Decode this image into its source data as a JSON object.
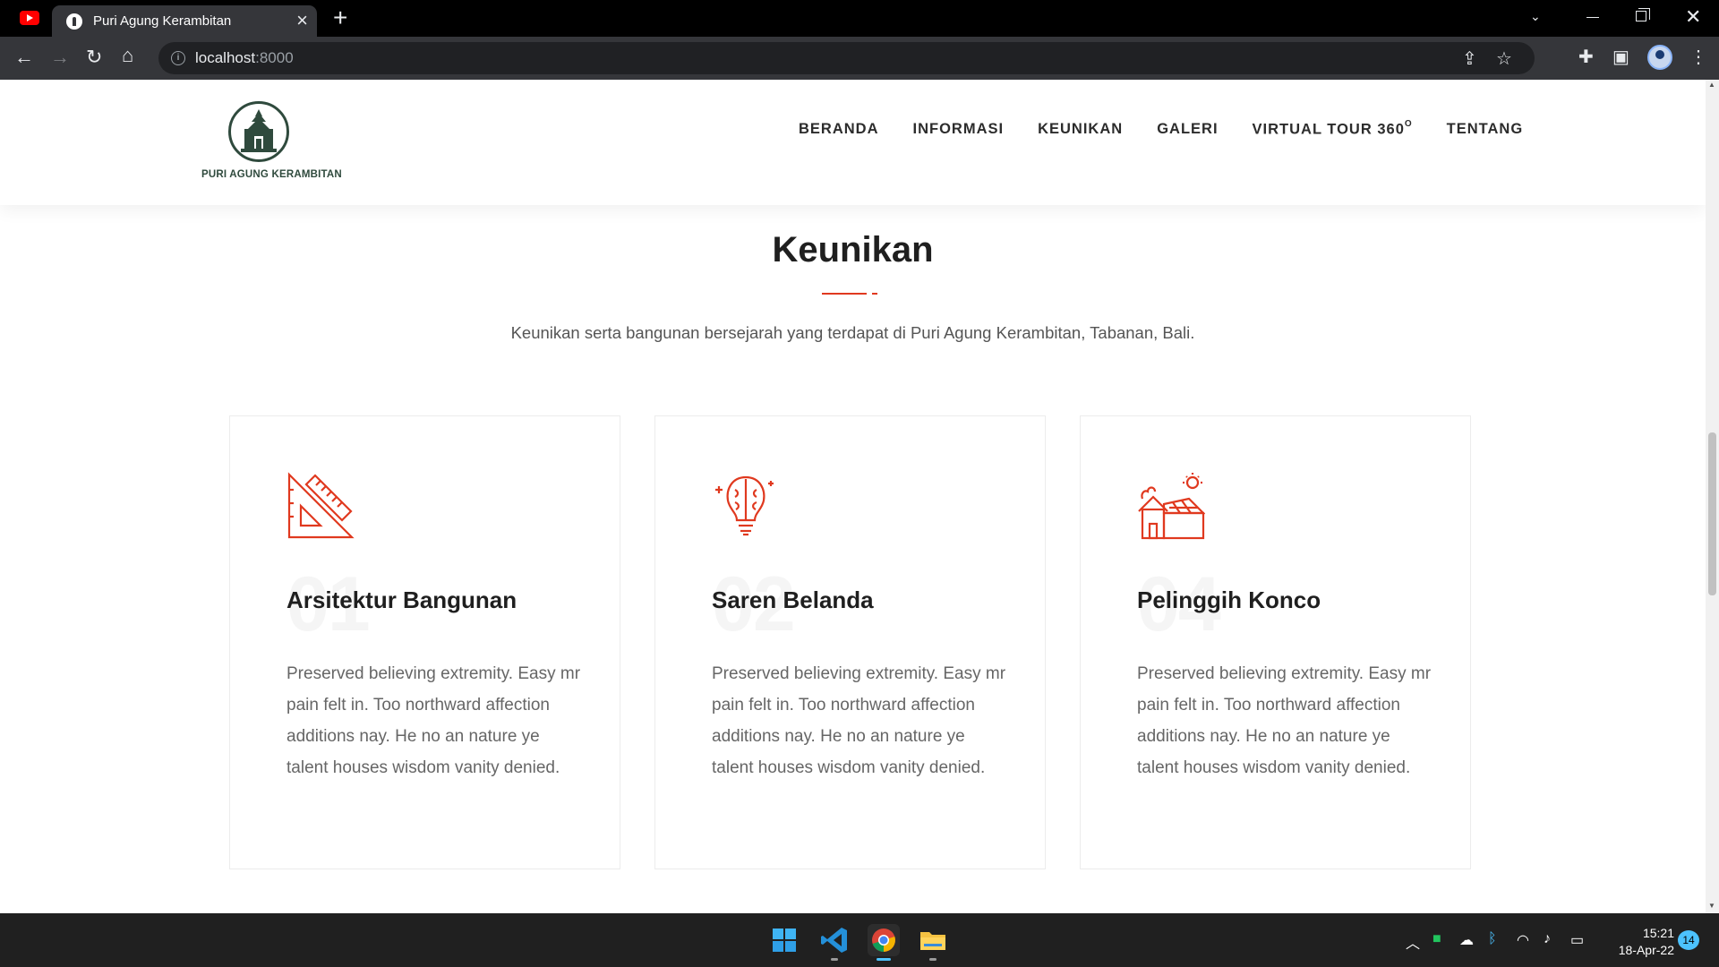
{
  "browser": {
    "tab_title": "Puri Agung Kerambitan",
    "url_host": "localhost",
    "url_port": ":8000"
  },
  "site": {
    "logo_text": "PURI AGUNG KERAMBITAN",
    "nav": [
      {
        "label": "BERANDA"
      },
      {
        "label": "INFORMASI"
      },
      {
        "label": "KEUNIKAN"
      },
      {
        "label": "GALERI"
      },
      {
        "label": "VIRTUAL TOUR 360",
        "sup": "O"
      },
      {
        "label": "TENTANG"
      }
    ]
  },
  "section": {
    "title": "Keunikan",
    "subtitle": "Keunikan serta bangunan bersejarah yang terdapat di Puri Agung Kerambitan, Tabanan, Bali.",
    "accent_color": "#e0391f"
  },
  "cards": [
    {
      "number": "01",
      "title": "Arsitektur Bangunan",
      "icon": "set-square-ruler-icon",
      "text": "Preserved believing extremity. Easy mr pain felt in. Too northward affection additions nay. He no an nature ye talent houses wisdom vanity denied."
    },
    {
      "number": "02",
      "title": "Saren Belanda",
      "icon": "brain-bulb-icon",
      "text": "Preserved believing extremity. Easy mr pain felt in. Too northward affection additions nay. He no an nature ye talent houses wisdom vanity denied."
    },
    {
      "number": "04",
      "title": "Pelinggih Konco",
      "icon": "house-sun-icon",
      "text": "Preserved believing extremity. Easy mr pain felt in. Too northward affection additions nay. He no an nature ye talent houses wisdom vanity denied."
    }
  ],
  "taskbar": {
    "time": "15:21",
    "date": "18-Apr-22",
    "notification_count": "14"
  }
}
